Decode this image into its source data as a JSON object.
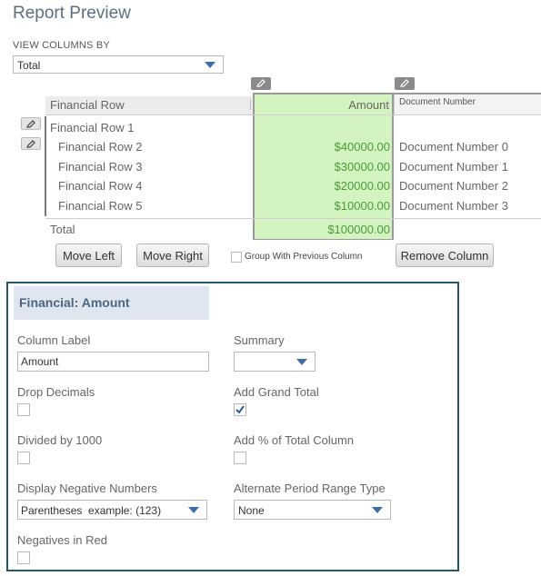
{
  "page": {
    "title": "Report Preview"
  },
  "view_columns": {
    "label": "VIEW COLUMNS BY",
    "value": "Total"
  },
  "table": {
    "headers": {
      "row": "Financial Row",
      "amount": "Amount",
      "doc": "Document Number"
    },
    "parent_row": "Financial Row 1",
    "rows": [
      {
        "label": "Financial Row 2",
        "amount": "$40000.00",
        "doc": "Document Number 0"
      },
      {
        "label": "Financial Row 3",
        "amount": "$30000.00",
        "doc": "Document Number 1"
      },
      {
        "label": "Financial Row 4",
        "amount": "$20000.00",
        "doc": "Document Number 2"
      },
      {
        "label": "Financial Row 5",
        "amount": "$10000.00",
        "doc": "Document Number 3"
      }
    ],
    "total_label": "Total",
    "total_amount": "$100000.00"
  },
  "actions": {
    "move_left": "Move Left",
    "move_right": "Move Right",
    "group_with_previous": "Group With Previous Column",
    "remove_column": "Remove Column"
  },
  "panel": {
    "heading": "Financial: Amount",
    "column_label": {
      "label": "Column Label",
      "value": "Amount"
    },
    "summary": {
      "label": "Summary",
      "value": ""
    },
    "drop_decimals": {
      "label": "Drop Decimals",
      "checked": false
    },
    "add_grand_total": {
      "label": "Add Grand Total",
      "checked": true
    },
    "divided_by_1000": {
      "label": "Divided by 1000",
      "checked": false
    },
    "add_pct_total": {
      "label": "Add % of Total Column",
      "checked": false
    },
    "display_negative": {
      "label": "Display Negative Numbers",
      "value": "Parentheses  example: (123)"
    },
    "alt_period": {
      "label": "Alternate Period Range Type",
      "value": "None"
    },
    "negatives_red": {
      "label": "Negatives in Red",
      "checked": false
    }
  },
  "colors": {
    "accent": "#3b6fa8",
    "highlight": "#d3f4c0",
    "money": "#4a9a3a",
    "panel_border": "#24596b"
  },
  "icons": [
    "pencil-icon",
    "chevron-down-icon",
    "checkmark-icon"
  ]
}
